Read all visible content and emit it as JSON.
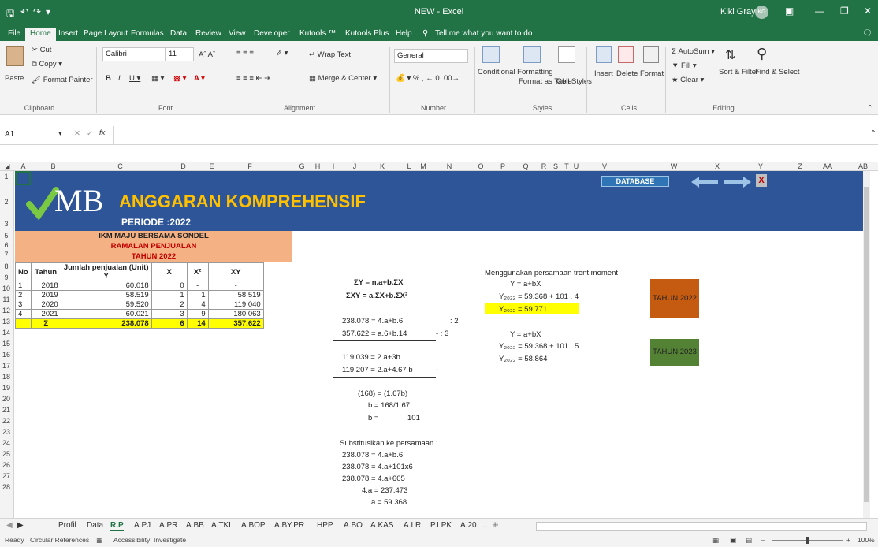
{
  "titlebar": {
    "title": "NEW  -  Excel",
    "user": "Kiki Gray",
    "initials": "KG"
  },
  "tabs": [
    "File",
    "Home",
    "Insert",
    "Page Layout",
    "Formulas",
    "Data",
    "Review",
    "View",
    "Developer",
    "Kutools ™",
    "Kutools Plus",
    "Help",
    "Tell me what you want to do"
  ],
  "ribbon": {
    "clipboard": {
      "cut": "Cut",
      "copy": "Copy",
      "paste": "Paste",
      "format_painter": "Format Painter",
      "group": "Clipboard"
    },
    "font": {
      "name": "Calibri",
      "size": "11",
      "group": "Font"
    },
    "alignment": {
      "wrap": "Wrap Text",
      "merge": "Merge & Center",
      "group": "Alignment"
    },
    "number": {
      "format": "General",
      "group": "Number"
    },
    "styles": {
      "conditional": "Conditional Formatting",
      "format_table": "Format as Table",
      "cell_styles": "Cell Styles",
      "group": "Styles"
    },
    "cells": {
      "insert": "Insert",
      "delete": "Delete",
      "format": "Format",
      "group": "Cells"
    },
    "editing": {
      "autosum": "AutoSum",
      "fill": "Fill",
      "clear": "Clear",
      "sort": "Sort & Filter",
      "find": "Find & Select",
      "group": "Editing"
    }
  },
  "formula_bar": {
    "name_box": "A1",
    "fx": "fx"
  },
  "columns": [
    "A",
    "B",
    "C",
    "D",
    "E",
    "F",
    "G",
    "H",
    "I",
    "J",
    "K",
    "L",
    "M",
    "N",
    "O",
    "P",
    "Q",
    "R",
    "S",
    "T",
    "U",
    "V",
    "W",
    "X",
    "Y",
    "Z",
    "AA",
    "AB"
  ],
  "rows": [
    "1",
    "2",
    "3",
    "5",
    "6",
    "7",
    "8",
    "9",
    "10",
    "11",
    "12",
    "13",
    "14",
    "15",
    "16",
    "17",
    "18",
    "19",
    "20",
    "21",
    "22",
    "23",
    "24",
    "25",
    "26",
    "27",
    "28"
  ],
  "banner": {
    "logo": "MB",
    "title": "ANGGARAN KOMPREHENSIF",
    "period": "PERIODE :2022",
    "database_button": "DATABASE",
    "close": "X"
  },
  "table": {
    "company": "IKM  MAJU BERSAMA SONDEL",
    "subtitle": "RAMALAN PENJUALAN",
    "year": "TAHUN 2022",
    "headers": [
      "No",
      "Tahun",
      "Jumlah penjualan (Unit) Y",
      "X",
      "X²",
      "XY"
    ],
    "rows": [
      [
        "1",
        "2018",
        "60.018",
        "0",
        "-",
        "-"
      ],
      [
        "2",
        "2019",
        "58.519",
        "1",
        "1",
        "58.519"
      ],
      [
        "3",
        "2020",
        "59.520",
        "2",
        "4",
        "119.040"
      ],
      [
        "4",
        "2021",
        "60.021",
        "3",
        "9",
        "180.063"
      ]
    ],
    "total": [
      "",
      "Σ",
      "238.078",
      "6",
      "14",
      "357.622"
    ]
  },
  "calc": {
    "eq1": "ΣY = n.a+b.ΣX",
    "eq2": "ΣXY = a.ΣX+b.ΣX²",
    "l1": "238.078 = 4.a+b.6",
    "l1r": ": 2",
    "l2": "357.622 = a.6+b.14",
    "l2r": "-  : 3",
    "l3": "119.039 = 2.a+3b",
    "l4": "119.207 = 2.a+4.67 b",
    "l4r": "-",
    "l5": "(168) = (1.67b)",
    "l6": "b = 168/1.67",
    "l7a": "b =",
    "l7b": "101",
    "subst": "Substitusikan ke persamaan :",
    "s1": "238.078 = 4.a+b.6",
    "s2": "238.078 = 4.a+101x6",
    "s3": "238.078 = 4.a+605",
    "s4": "4.a =  237.473",
    "s5": "a =  59.368"
  },
  "trend": {
    "title": "Menggunakan persamaan trent moment",
    "y1": "Y = a+bX",
    "y2022a": "Y₂₀₂₂ =  59.368  +  101  .  4",
    "y2022b": "Y₂₀₂₂ =  59.771",
    "y2": "Y = a+bX",
    "y2023a": "Y₂₀₂₃ =  59.368  +  101  .  5",
    "y2023b": "Y₂₀₂₃ =  58.864",
    "btn2022": "TAHUN 2022",
    "btn2023": "TAHUN 2023"
  },
  "sheet_tabs": [
    "Profil",
    "Data",
    "R.P",
    "A.PJ",
    "A.PR",
    "A.BB",
    "A.TKL",
    "A.BOP",
    "A.BY.PR",
    "HPP",
    "A.BO",
    "A.KAS",
    "A.LR",
    "P.LPK",
    "A.20. ..."
  ],
  "status": {
    "ready": "Ready",
    "circular": "Circular References",
    "accessibility": "Accessibility: Investigate",
    "zoom": "100%"
  },
  "colors": {
    "excel_green": "#217346",
    "banner_blue": "#2e5597",
    "header_peach": "#f4b183",
    "highlight_yellow": "#ffff00",
    "tahun2022": "#c55a11",
    "tahun2023": "#548235"
  }
}
